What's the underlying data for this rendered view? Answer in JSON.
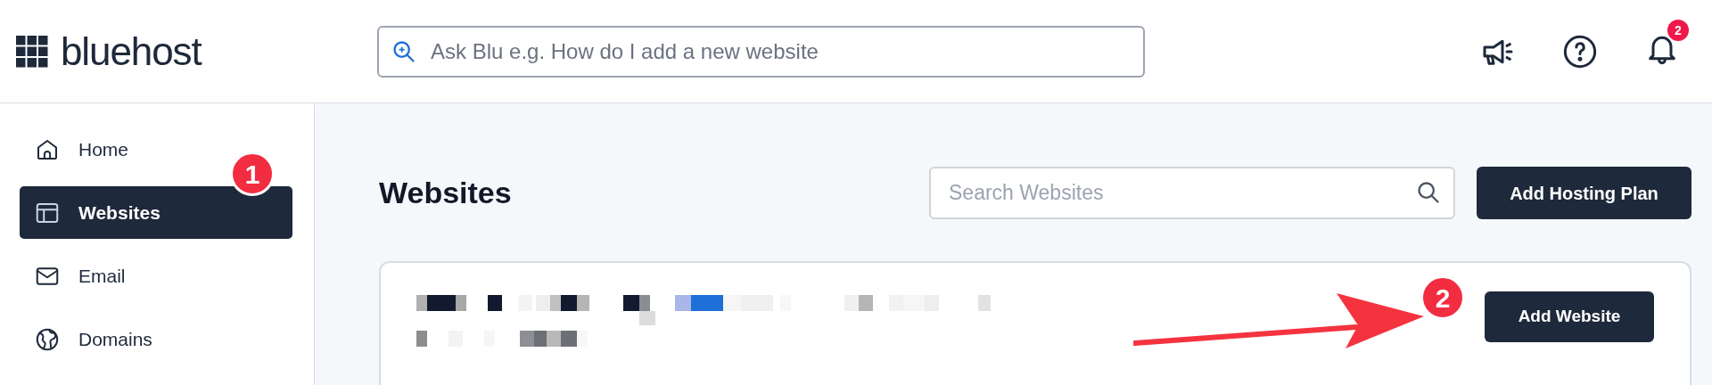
{
  "header": {
    "logo": "bluehost",
    "ask_field": {
      "placeholder": "Ask Blu e.g. How do I add a new website"
    },
    "notifications": {
      "count": "2"
    }
  },
  "sidebar": {
    "items": [
      {
        "label": "Home",
        "kind": "home",
        "selected": false
      },
      {
        "label": "Websites",
        "kind": "websites",
        "selected": true
      },
      {
        "label": "Email",
        "kind": "email",
        "selected": false
      },
      {
        "label": "Domains",
        "kind": "domains",
        "selected": false
      }
    ]
  },
  "annotations": [
    {
      "label": "1"
    },
    {
      "label": "2"
    }
  ],
  "main": {
    "title": "Websites",
    "search": {
      "placeholder": "Search Websites"
    },
    "add_plan_button": "Add Hosting Plan",
    "card": {
      "button": "Add Website"
    }
  }
}
